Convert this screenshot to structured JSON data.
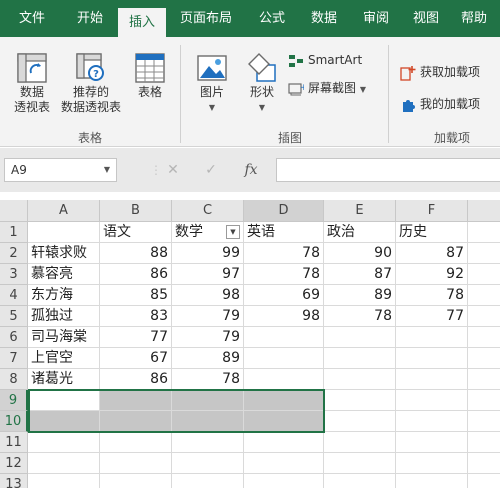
{
  "ribbon_tabs": [
    "文件",
    "开始",
    "插入",
    "页面布局",
    "公式",
    "数据",
    "审阅",
    "视图",
    "帮助"
  ],
  "active_tab": "插入",
  "tables_group": {
    "label": "表格",
    "buttons": [
      {
        "line1": "数据",
        "line2": "透视表"
      },
      {
        "line1": "推荐的",
        "line2": "数据透视表"
      },
      {
        "line1": "表格",
        "line2": ""
      }
    ]
  },
  "illustrations_group": {
    "label": "插图",
    "pictures": "图片",
    "shapes": "形状",
    "smartart": "SmartArt",
    "screenshot": "屏幕截图"
  },
  "addins_group": {
    "label": "加载项",
    "get_addins": "获取加载项",
    "my_addins": "我的加载项"
  },
  "formula_bar": {
    "name_box": "A9",
    "cancel_glyph": "✕",
    "enter_glyph": "✓",
    "fx": "fx",
    "formula": ""
  },
  "columns": [
    "A",
    "B",
    "C",
    "D",
    "E",
    "F"
  ],
  "rows": [
    [
      "",
      "语文",
      "数学",
      "英语",
      "政治",
      "历史"
    ],
    [
      "轩辕求败",
      "88",
      "99",
      "78",
      "90",
      "87"
    ],
    [
      "慕容亮",
      "86",
      "97",
      "78",
      "87",
      "92"
    ],
    [
      "东方海",
      "85",
      "98",
      "69",
      "89",
      "78"
    ],
    [
      "孤独过",
      "83",
      "79",
      "98",
      "78",
      "77"
    ],
    [
      "司马海棠",
      "77",
      "79",
      "",
      "",
      ""
    ],
    [
      "上官空",
      "67",
      "89",
      "",
      "",
      ""
    ],
    [
      "诸葛光",
      "86",
      "78",
      "",
      "",
      ""
    ],
    [
      "",
      "",
      "",
      "",
      "",
      ""
    ],
    [
      "",
      "",
      "",
      "",
      "",
      ""
    ],
    [
      "",
      "",
      "",
      "",
      "",
      ""
    ],
    [
      "",
      "",
      "",
      "",
      "",
      ""
    ],
    [
      "",
      "",
      "",
      "",
      "",
      ""
    ]
  ],
  "row_numbers": [
    "1",
    "2",
    "3",
    "4",
    "5",
    "6",
    "7",
    "8",
    "9",
    "10",
    "11",
    "12",
    "13"
  ],
  "colors": {
    "brand": "#217346",
    "selection": "#c6c6c6"
  }
}
